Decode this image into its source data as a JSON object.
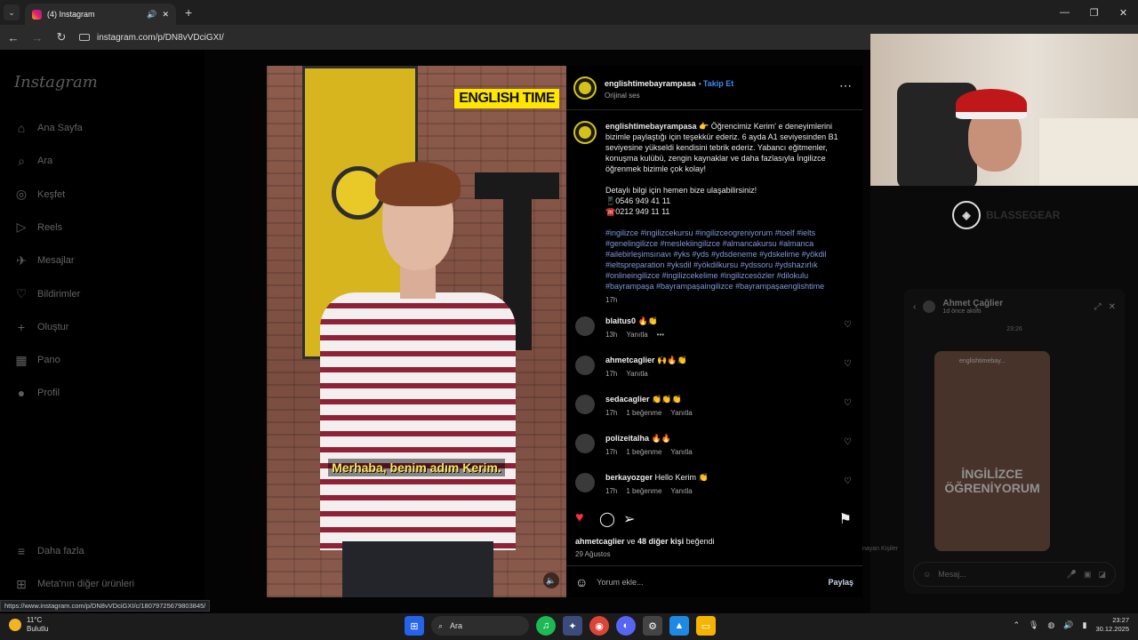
{
  "browser": {
    "tab_title": "(4) Instagram",
    "url": "instagram.com/p/DN8vVDciGXI/",
    "status_url": "https://www.instagram.com/p/DN8vVDciGXI/c/18079725679803845/"
  },
  "sidebar": {
    "logo": "Instagram",
    "items": [
      {
        "label": "Ana Sayfa",
        "icon": "home-icon",
        "glyph": "⌂"
      },
      {
        "label": "Ara",
        "icon": "search-icon",
        "glyph": "⌕"
      },
      {
        "label": "Keşfet",
        "icon": "explore-icon",
        "glyph": "◎"
      },
      {
        "label": "Reels",
        "icon": "reels-icon",
        "glyph": "▷"
      },
      {
        "label": "Mesajlar",
        "icon": "messages-icon",
        "glyph": "✈"
      },
      {
        "label": "Bildirimler",
        "icon": "heart-icon",
        "glyph": "♡"
      },
      {
        "label": "Oluştur",
        "icon": "plus-icon",
        "glyph": "+"
      },
      {
        "label": "Pano",
        "icon": "dashboard-icon",
        "glyph": "▦"
      },
      {
        "label": "Profil",
        "icon": "profile-icon",
        "glyph": "●"
      }
    ],
    "more": "Daha fazla",
    "meta": "Meta'nın diğer ürünleri"
  },
  "video": {
    "brand": "ENGLISH TIME",
    "subtitle": "Merhaba, benim adım Kerim."
  },
  "post": {
    "username": "englishtimebayrampasa",
    "follow": "Takip Et",
    "audio": "Orijinal ses",
    "caption_user": "englishtimebayrampasa",
    "caption_text": "👉 Öğrencimiz Kerim' e deneyimlerini bizimle paylaştığı için teşekkür ederiz. 6 ayda A1 seviyesinden B1 seviyesine yükseldi kendisini tebrik ederiz. Yabancı eğitmenler, konuşma kulübü, zengin kaynaklar ve daha fazlasıyla İngilizce öğrenmek bizimle çok kolay!",
    "caption_contact": "Detaylı bilgi için hemen bize ulaşabilirsiniz!",
    "phone1": "📱0546 949 41 11",
    "phone2": "☎️0212 949 11 11",
    "tags": "#ingilizce #ingilizcekursu #ingilizceogreniyorum #toelf #ielts #genelingilizce #meslekiingilizce #almancakursu #almanca #ailebirleşimsınavı #yks #yds #ydsdeneme #ydskelime #yökdil #ieltspreparation #yksdil #yökdilkursu #ydssoru #ydshazırlık #onlineingilizce #ingilizcekelime #ingilizcesözler  #dilokulu #bayrampaşa #bayrampaşaingilizce #bayrampaşaenglishtime",
    "caption_time": "17h",
    "comments": [
      {
        "user": "blaitus0",
        "text": "🔥👏",
        "time": "13h",
        "likes": "",
        "reply": "Yanıtla",
        "more": "•••"
      },
      {
        "user": "ahmetcaglier",
        "text": "🙌🔥👏",
        "time": "17h",
        "likes": "",
        "reply": "Yanıtla",
        "more": ""
      },
      {
        "user": "sedacaglier",
        "text": "👏👏👏",
        "time": "17h",
        "likes": "1 beğenme",
        "reply": "Yanıtla",
        "more": ""
      },
      {
        "user": "polizeitalha",
        "text": "🔥🔥",
        "time": "17h",
        "likes": "1 beğenme",
        "reply": "Yanıtla",
        "more": ""
      },
      {
        "user": "berkayozger",
        "text": "Hello Kerim 👏",
        "time": "17h",
        "likes": "1 beğenme",
        "reply": "Yanıtla",
        "more": ""
      }
    ],
    "liked_by_user": "ahmetcaglier",
    "liked_by_rest": " ve ",
    "liked_by_count": "48 diğer kişi",
    "liked_by_suffix": " beğendi",
    "date": "29 Ağustos",
    "comment_placeholder": "Yorum ekle...",
    "share": "Paylaş",
    "like_color": "#ff3040"
  },
  "overlay": {
    "brand": "BLASSEGEAR",
    "chat_name": "Ahmet Çağlier",
    "chat_status": "1d önce aktifti",
    "chat_time": "23:26",
    "chat_thumb_user": "englishtimebay...",
    "chat_thumb_text": "İNGİLİZCE ÖĞRENİYORUM",
    "chat_placeholder": "Mesaj...",
    "side_text": "nayan Kişiler"
  },
  "taskbar": {
    "temp": "11°C",
    "weather": "Bulutlu",
    "search": "Ara",
    "time": "23:27",
    "date": "30.12.2025",
    "discord_badge": "1"
  }
}
